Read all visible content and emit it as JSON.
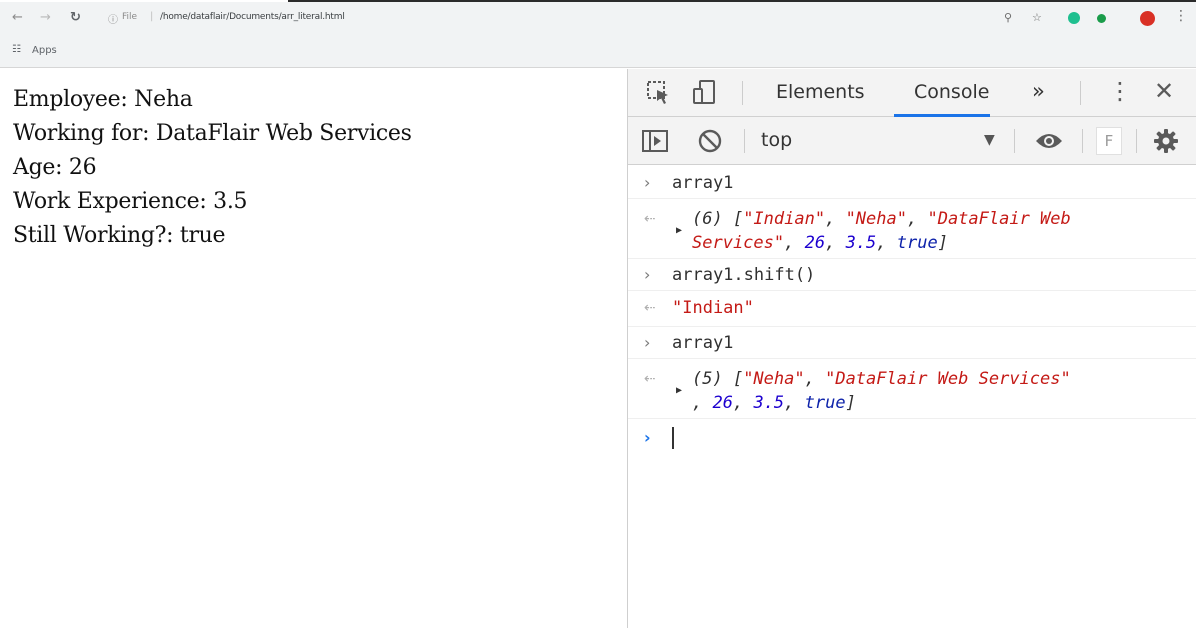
{
  "browser": {
    "url_info": "ⓘ",
    "url_scheme": "File",
    "url_sep": "|",
    "url": "/home/dataflair/Documents/arr_literal.html",
    "bookmarks_label": "Apps"
  },
  "page": {
    "lines": [
      "Employee: Neha",
      "Working for: DataFlair Web Services",
      "Age: 26",
      "Work Experience: 3.5",
      "Still Working?: true"
    ]
  },
  "devtools": {
    "tabs": [
      "Elements",
      "Console",
      "»"
    ],
    "active_tab": "Console",
    "context": "top",
    "filter_letter": "F",
    "console": [
      {
        "kind": "input",
        "code": "array1"
      },
      {
        "kind": "output",
        "line1": {
          "count": "(6) [",
          "a": "\"Indian\"",
          "c1": ", ",
          "b": "\"Neha\"",
          "c2": ", ",
          "c": "\"DataFlair Web"
        },
        "line2": {
          "a": "Services\"",
          "c1": ", ",
          "n1": "26",
          "c2": ", ",
          "n2": "3.5",
          "c3": ", ",
          "k": "true",
          "end": "]"
        }
      },
      {
        "kind": "input",
        "code": "array1.shift()"
      },
      {
        "kind": "output-simple",
        "value": "\"Indian\""
      },
      {
        "kind": "input",
        "code": "array1"
      },
      {
        "kind": "output",
        "line1": {
          "count": "(5) [",
          "a": "\"Neha\"",
          "c1": ", ",
          "b": "\"DataFlair Web Services\""
        },
        "line2": {
          "c0": ", ",
          "n1": "26",
          "c2": ", ",
          "n2": "3.5",
          "c3": ", ",
          "k": "true",
          "end": "]"
        }
      }
    ]
  },
  "colors": {
    "accent": "#1a73e8",
    "string": "#c41a16",
    "number": "#1c00cf",
    "keyword": "#0d22aa"
  }
}
